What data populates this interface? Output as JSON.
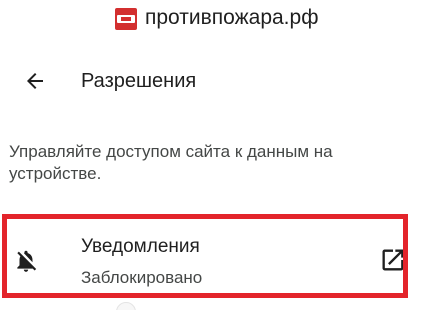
{
  "site": {
    "name": "противпожара.рф",
    "favicon_icon": "site-favicon"
  },
  "toolbar": {
    "back_icon": "arrow-back-icon",
    "title": "Разрешения"
  },
  "description": "Управляйте доступом сайта к данным на устройстве.",
  "permissions": [
    {
      "title": "Уведомления",
      "status": "Заблокировано",
      "icon": "bell-off-icon",
      "action_icon": "open-external-icon"
    }
  ],
  "colors": {
    "text_primary": "#1f1f1f",
    "text_secondary": "#444746",
    "highlight_border": "#e3242b",
    "favicon_red": "#d32f2f"
  }
}
